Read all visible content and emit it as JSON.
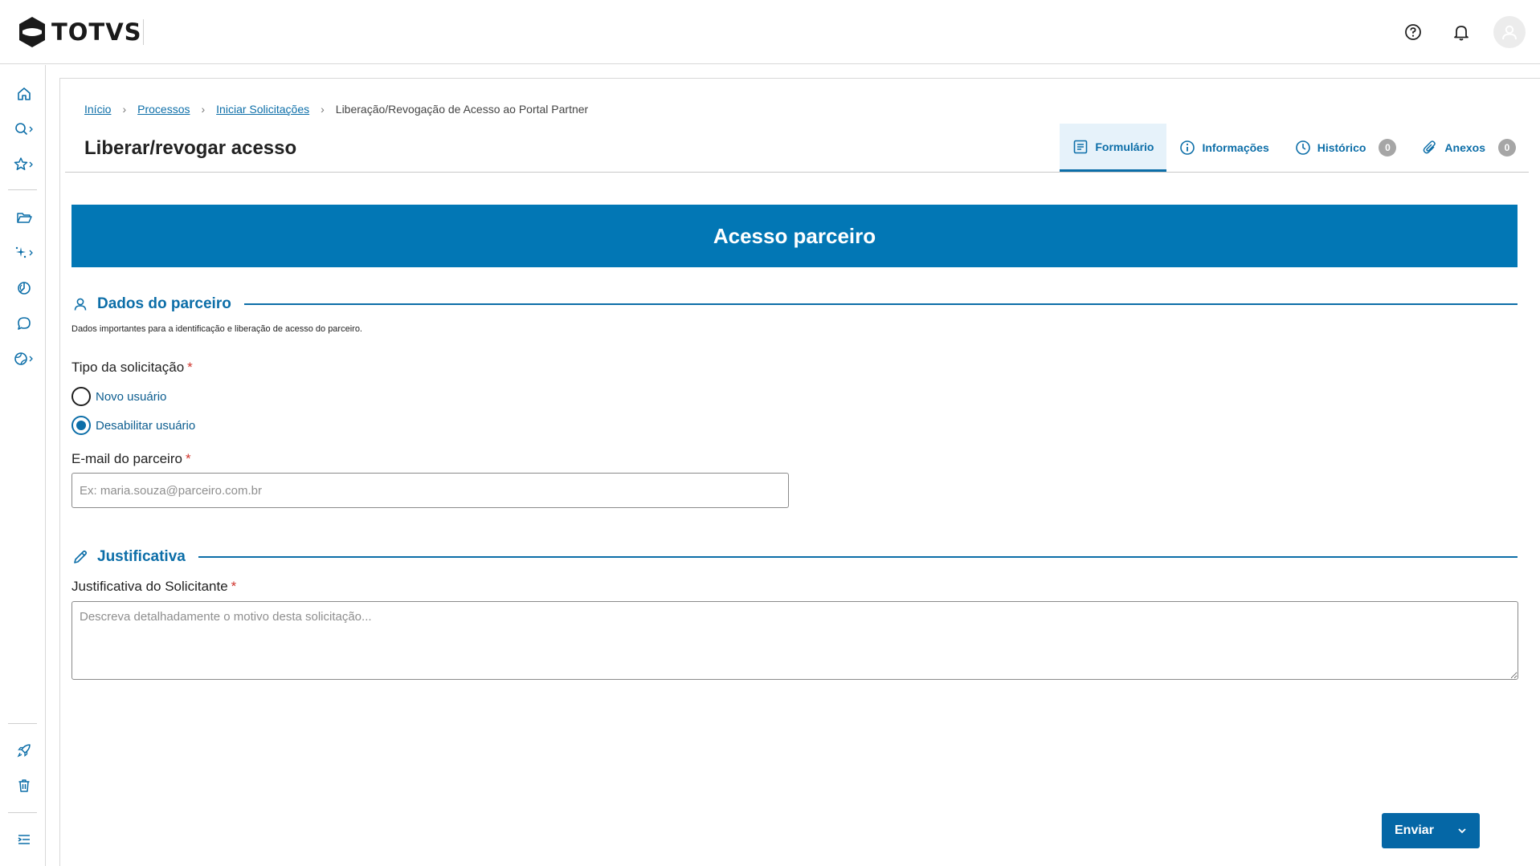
{
  "app": {
    "brand": "TOTVS"
  },
  "topbar": {
    "icons": [
      "help-icon",
      "bell-icon",
      "user-avatar"
    ]
  },
  "rail": {
    "items": [
      "home-icon",
      "search-icon",
      "star-icon",
      "folder-icon",
      "sparkle-icon",
      "chart-icon",
      "chat-icon",
      "globe-icon",
      "rocket-icon",
      "trash-icon",
      "menu-collapse-icon"
    ]
  },
  "breadcrumb": {
    "items": [
      "Início",
      "Processos",
      "Iniciar Solicitações"
    ],
    "current": "Liberação/Revogação de Acesso ao Portal Partner"
  },
  "page": {
    "title": "Liberar/revogar acesso"
  },
  "tabs": [
    {
      "label": "Formulário",
      "icon": "form-icon",
      "active": true
    },
    {
      "label": "Informações",
      "icon": "info-icon"
    },
    {
      "label": "Histórico",
      "icon": "clock-icon",
      "count": "0"
    },
    {
      "label": "Anexos",
      "icon": "paperclip-icon",
      "count": "0"
    }
  ],
  "banner": {
    "title": "Acesso parceiro"
  },
  "section_partner": {
    "title": "Dados do parceiro",
    "description": "Dados importantes para a identificação e liberação de acesso do parceiro.",
    "request_type_label": "Tipo da solicitação",
    "required_mark": "*",
    "options": [
      "Novo usuário",
      "Desabilitar usuário"
    ],
    "selected_option": "Desabilitar usuário",
    "email_label": "E-mail do parceiro",
    "email_placeholder": "Ex: maria.souza@parceiro.com.br",
    "email_value": ""
  },
  "section_justification": {
    "title": "Justificativa",
    "field_label": "Justificativa do Solicitante",
    "required_mark": "*",
    "placeholder": "Descreva detalhadamente o motivo desta solicitação...",
    "value": ""
  },
  "actions": {
    "send_label": "Enviar"
  },
  "colors": {
    "primary": "#0277b5",
    "link": "#0c6ea8",
    "required": "#d0342c",
    "tab_active_bg": "#e6f2fa"
  }
}
